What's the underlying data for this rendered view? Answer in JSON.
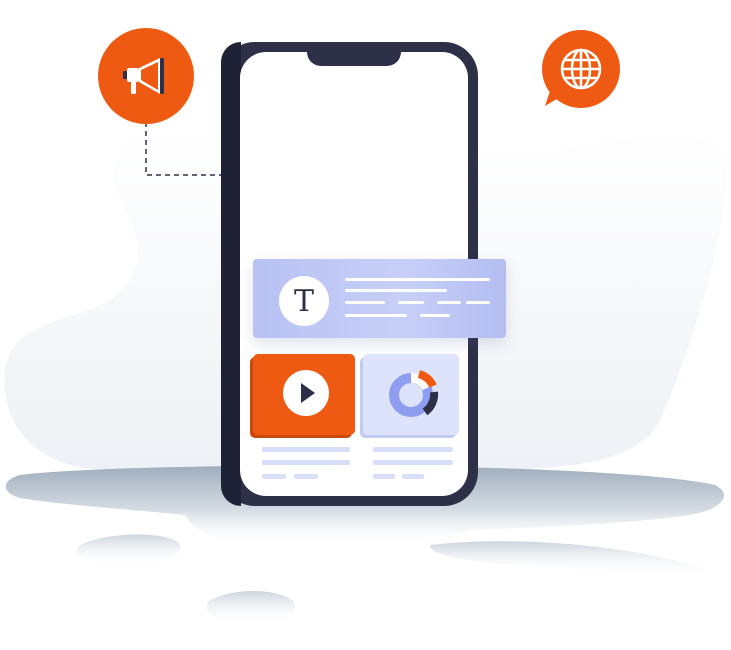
{
  "illustration": {
    "text_card_letter": "T",
    "icons": [
      "megaphone-icon",
      "globe-icon",
      "play-icon",
      "donut-chart-icon"
    ]
  },
  "colors": {
    "accent": "#ee5a12",
    "phone_frame": "#2d3047",
    "card_periwinkle": "#bac4f4",
    "chart_card_bg": "#dde3fb",
    "shadow": "#a9b6c4"
  }
}
